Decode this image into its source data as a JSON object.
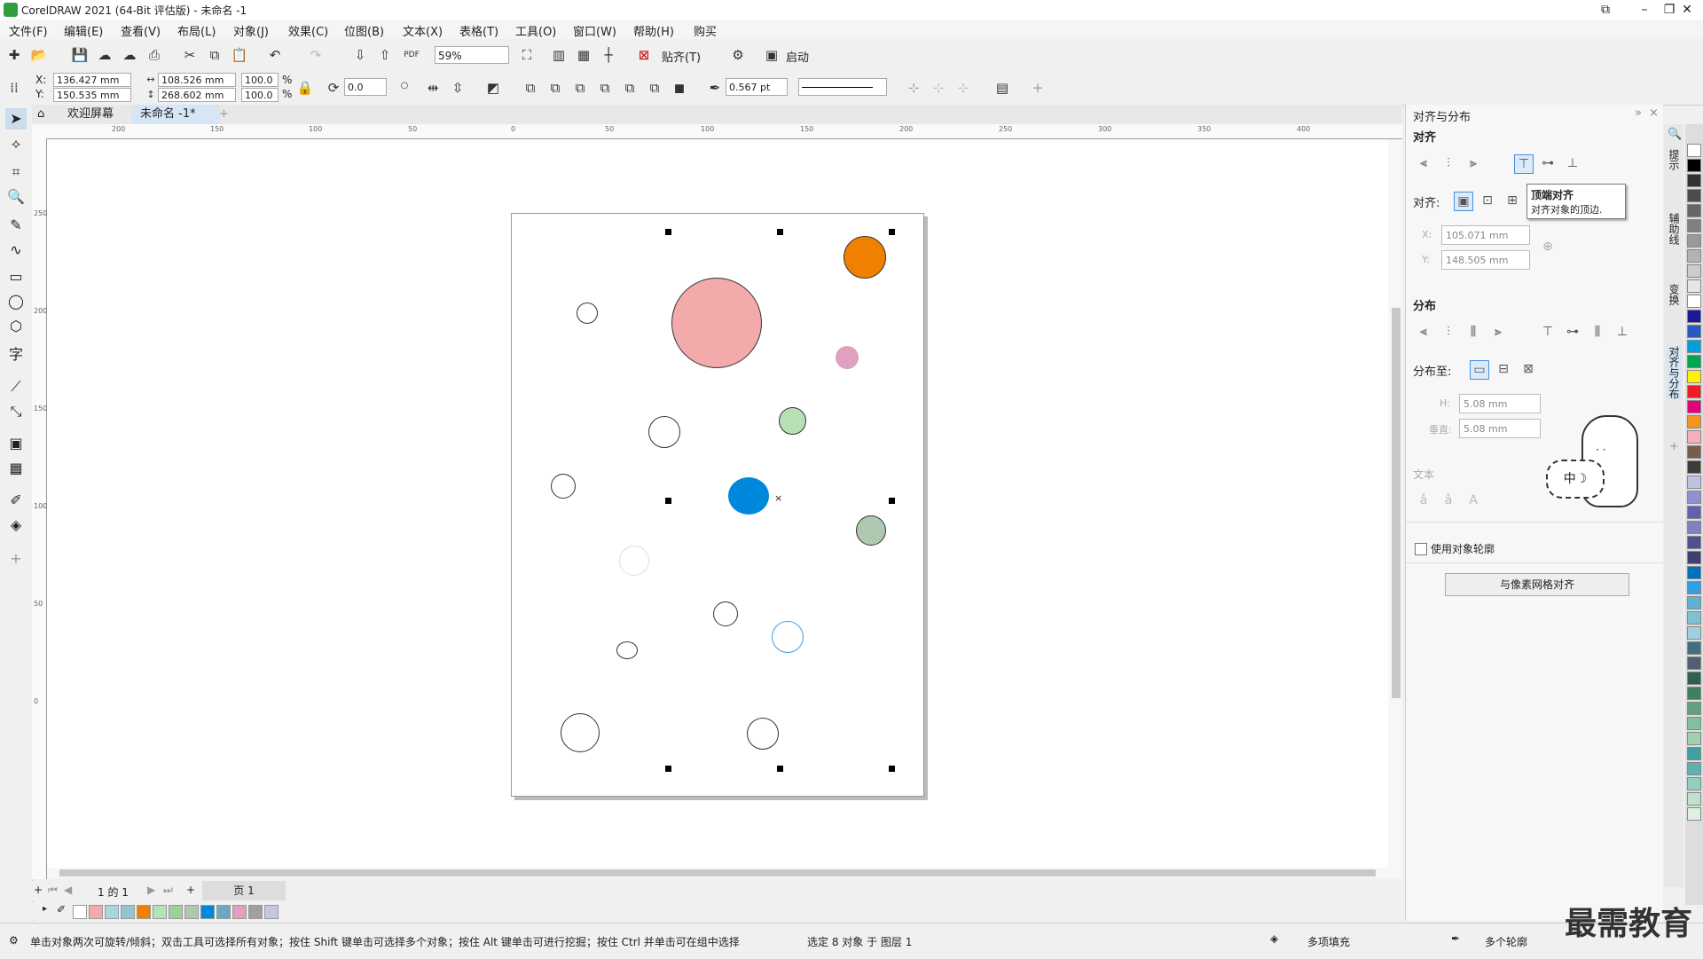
{
  "window": {
    "title": "CorelDRAW 2021 (64-Bit 评估版) - 未命名 -1"
  },
  "menu": [
    "文件(F)",
    "编辑(E)",
    "查看(V)",
    "布局(L)",
    "对象(J)",
    "效果(C)",
    "位图(B)",
    "文本(X)",
    "表格(T)",
    "工具(O)",
    "窗口(W)",
    "帮助(H)",
    "购买"
  ],
  "toolbar": {
    "zoom": "59%",
    "snap_label": "贴齐(T)",
    "launch_label": "启动"
  },
  "property_bar": {
    "x_label": "X:",
    "x_value": "136.427 mm",
    "y_label": "Y:",
    "y_value": "150.535 mm",
    "width_value": "108.526 mm",
    "height_value": "268.602 mm",
    "scale_w": "100.0",
    "scale_h": "100.0",
    "percent": "%",
    "rotation": "0.0",
    "outline_width": "0.567 pt"
  },
  "tabs": [
    {
      "label": "欢迎屏幕"
    },
    {
      "label": "未命名 -1*"
    }
  ],
  "hruler_ticks": [
    "200",
    "150",
    "100",
    "50",
    "0",
    "50",
    "100",
    "150",
    "200",
    "250",
    "300",
    "350",
    "400"
  ],
  "vruler_ticks": [
    "250",
    "200",
    "150",
    "100",
    "50",
    "0"
  ],
  "page_nav": {
    "position": "1 的 1",
    "page_tab": "页 1"
  },
  "status": {
    "hint": "单击对象两次可旋转/倾斜；双击工具可选择所有对象；按住 Shift 键单击可选择多个对象；按住 Alt 键单击可进行挖掘；按住 Ctrl 并单击可在组中选择",
    "selection": "选定 8 对象 于 图层 1",
    "fill": "多项填充",
    "outline": "多个轮廓"
  },
  "docker": {
    "title": "对齐与分布",
    "align_section": "对齐",
    "align_to_label": "对齐:",
    "x_label": "X:",
    "x_value": "105.071 mm",
    "y_label": "Y:",
    "y_value": "148.505 mm",
    "distribute_section": "分布",
    "distribute_to_label": "分布至:",
    "h_label": "H:",
    "h_value": "5.08 mm",
    "v_label": "垂直:",
    "v_value": "5.08 mm",
    "text_section": "文本",
    "use_outline_label": "使用对象轮廓",
    "pixel_grid_button": "与像素网格对齐",
    "tooltip_title": "顶端对齐",
    "tooltip_desc": "对齐对象的顶边."
  },
  "vertical_tabs": [
    "提示",
    "辅助线",
    "变换",
    "对齐与分布"
  ],
  "watermark": "最需教育",
  "doc_palette_colors": [
    "#f2aaaa",
    "#a9d4d8",
    "#8fc6d0",
    "#f08000",
    "#b7e0b5",
    "#9fcf9a",
    "#b0c8b0",
    "#0088dd",
    "#6ba7c7",
    "#e0a0c0",
    "#a0a0a0",
    "#c0c8e8"
  ],
  "color_palette": [
    "#ffffff",
    "#000000",
    "#333333",
    "#4d4d4d",
    "#666666",
    "#808080",
    "#999999",
    "#b3b3b3",
    "#cccccc",
    "#e6e6e6",
    "#ffffff",
    "#1a1a99",
    "#2b59c3",
    "#00a0e0",
    "#00a651",
    "#fff200",
    "#ed1c24",
    "#e4007f",
    "#f7941d",
    "#f5b0c0",
    "#7a5c4a",
    "#3c3c3c",
    "#c0c0e0",
    "#9090d0",
    "#6060b0",
    "#8080c0",
    "#505090",
    "#404070",
    "#0070c0",
    "#30a0e0",
    "#60b0d0",
    "#80c0d0",
    "#a0d0e0",
    "#407080",
    "#506070",
    "#306050",
    "#408060",
    "#60a080",
    "#80c0a0",
    "#a0d0b0",
    "#40a0a0",
    "#60b0b0",
    "#90d0c0",
    "#c0e0d0",
    "#e0f0e0"
  ]
}
